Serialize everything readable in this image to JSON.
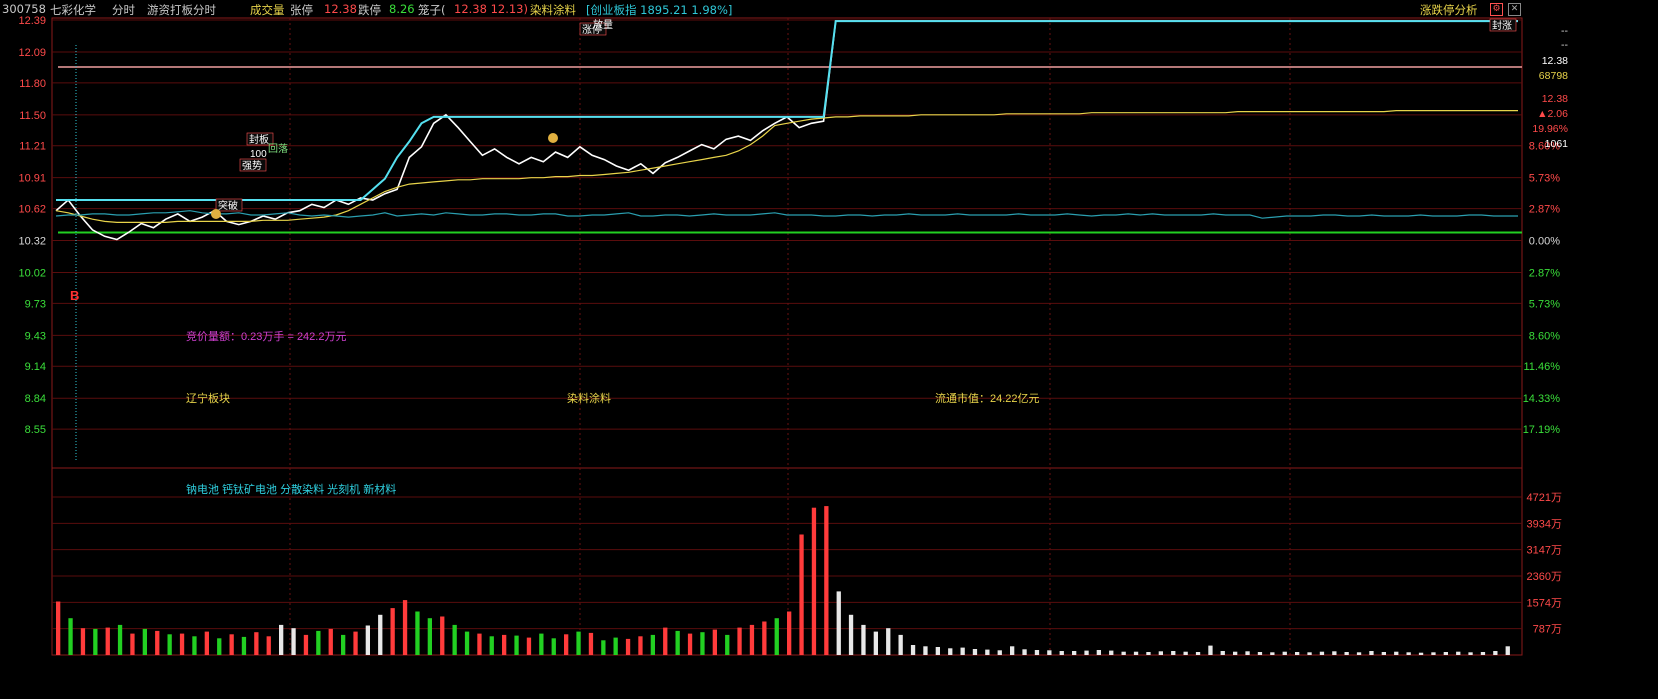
{
  "header": {
    "code": "300758",
    "name": "七彩化学",
    "mode": "分时",
    "strategy": "游资打板分时",
    "vol_label": "成交量",
    "limit_up_label": "张停",
    "limit_up_value": "12.38",
    "limit_down_label": "跌停",
    "limit_down_value": "8.26",
    "box_label": "笼子(",
    "box_values": "12.38 12.13)",
    "sector": "染料涂料",
    "index_text": "[创业板指 1895.21 1.98%]",
    "analysis_link": "涨跌停分析",
    "ctrl_icons": [
      "settings-icon",
      "close-icon"
    ]
  },
  "right_panel": {
    "dash1": "--",
    "dash2": "--",
    "price": "12.38",
    "volume": "68798",
    "price2": "12.38",
    "change": "▲2.06",
    "change_pct": "19.96%",
    "last_vol": "1061"
  },
  "chart_data": {
    "type": "line",
    "title": "300758 七彩化学 分时",
    "price_axis": {
      "ylim": [
        8.26,
        12.39
      ],
      "left_ticks": [
        "12.39",
        "12.09",
        "11.80",
        "11.50",
        "11.21",
        "10.91",
        "10.62",
        "10.32",
        "10.02",
        "9.73",
        "9.43",
        "9.14",
        "8.84",
        "8.55"
      ],
      "right_ticks": [
        "",
        "",
        "",
        "",
        "8.60%",
        "5.73%",
        "2.87%",
        "0.00%",
        "2.87%",
        "5.73%",
        "8.60%",
        "11.46%",
        "14.33%",
        "17.19%"
      ]
    },
    "prev_close": 10.32,
    "limit_up": 12.38,
    "limit_down": 8.26,
    "volume_axis": {
      "ticks": [
        "4721万",
        "3934万",
        "3147万",
        "2360万",
        "1574万",
        "787万"
      ]
    },
    "annotations": [
      {
        "text": "B",
        "kind": "buy"
      },
      {
        "text": "突破",
        "kind": "tag"
      },
      {
        "text": "强势",
        "kind": "tag"
      },
      {
        "text": "封板",
        "kind": "tag"
      },
      {
        "text": "回落",
        "kind": "tag"
      },
      {
        "text": "涨停",
        "kind": "tag"
      },
      {
        "text": "放量",
        "kind": "tag"
      },
      {
        "text": "封涨",
        "kind": "tag"
      },
      {
        "text": "100",
        "kind": "label"
      }
    ],
    "notes": {
      "auction": "竞价量额：0.23万手 = 242.2万元",
      "region": "辽宁板块",
      "industry": "染料涂料",
      "float_cap": "流通市值：24.22亿元",
      "concepts": "钠电池 钙钛矿电池 分散染料 光刻机 新材料"
    },
    "series": [
      {
        "name": "价格",
        "color": "#ffffff",
        "values": [
          10.6,
          10.7,
          10.55,
          10.42,
          10.36,
          10.33,
          10.4,
          10.48,
          10.44,
          10.52,
          10.57,
          10.5,
          10.54,
          10.6,
          10.5,
          10.47,
          10.5,
          10.55,
          10.52,
          10.58,
          10.6,
          10.66,
          10.63,
          10.7,
          10.66,
          10.72,
          10.7,
          10.76,
          10.8,
          11.1,
          11.2,
          11.42,
          11.5,
          11.38,
          11.25,
          11.12,
          11.18,
          11.1,
          11.04,
          11.1,
          11.06,
          11.15,
          11.1,
          11.2,
          11.12,
          11.08,
          11.02,
          10.98,
          11.04,
          10.95,
          11.05,
          11.1,
          11.16,
          11.22,
          11.18,
          11.27,
          11.3,
          11.26,
          11.35,
          11.42,
          11.48,
          11.38,
          11.42,
          11.44,
          12.38,
          12.38,
          12.38,
          12.38,
          12.38,
          12.38,
          12.38,
          12.38,
          12.38,
          12.38,
          12.38,
          12.38,
          12.38,
          12.38,
          12.38,
          12.38,
          12.38,
          12.38,
          12.38,
          12.38,
          12.38,
          12.38,
          12.38,
          12.38,
          12.38,
          12.38,
          12.38,
          12.38,
          12.38,
          12.38,
          12.38,
          12.38,
          12.38,
          12.38,
          12.38,
          12.38,
          12.38,
          12.38,
          12.38,
          12.38,
          12.38,
          12.38,
          12.38,
          12.38,
          12.38,
          12.38,
          12.38,
          12.38,
          12.38,
          12.38,
          12.38,
          12.38,
          12.38,
          12.38,
          12.38,
          12.38,
          12.38
        ]
      },
      {
        "name": "均价",
        "color": "#e8d44a",
        "values": [
          10.6,
          10.58,
          10.55,
          10.52,
          10.5,
          10.49,
          10.49,
          10.49,
          10.49,
          10.49,
          10.5,
          10.5,
          10.5,
          10.5,
          10.5,
          10.5,
          10.5,
          10.51,
          10.51,
          10.51,
          10.52,
          10.53,
          10.54,
          10.56,
          10.6,
          10.66,
          10.72,
          10.78,
          10.82,
          10.85,
          10.86,
          10.87,
          10.88,
          10.89,
          10.89,
          10.9,
          10.9,
          10.9,
          10.9,
          10.91,
          10.91,
          10.92,
          10.92,
          10.93,
          10.93,
          10.94,
          10.95,
          10.96,
          10.98,
          11.0,
          11.02,
          11.04,
          11.06,
          11.08,
          11.1,
          11.12,
          11.16,
          11.22,
          11.3,
          11.4,
          11.42,
          11.44,
          11.46,
          11.47,
          11.48,
          11.48,
          11.49,
          11.49,
          11.49,
          11.49,
          11.49,
          11.5,
          11.5,
          11.5,
          11.5,
          11.5,
          11.5,
          11.5,
          11.51,
          11.51,
          11.51,
          11.51,
          11.51,
          11.51,
          11.51,
          11.52,
          11.52,
          11.52,
          11.52,
          11.52,
          11.52,
          11.52,
          11.52,
          11.52,
          11.52,
          11.52,
          11.52,
          11.53,
          11.53,
          11.53,
          11.53,
          11.53,
          11.53,
          11.53,
          11.53,
          11.53,
          11.53,
          11.53,
          11.53,
          11.53,
          11.54,
          11.54,
          11.54,
          11.54,
          11.54,
          11.54,
          11.54,
          11.54,
          11.54,
          11.54,
          11.54
        ]
      },
      {
        "name": "板块",
        "color": "#2a9fb0",
        "values": [
          10.55,
          10.56,
          10.56,
          10.57,
          10.57,
          10.56,
          10.56,
          10.57,
          10.58,
          10.58,
          10.59,
          10.6,
          10.58,
          10.57,
          10.57,
          10.58,
          10.56,
          10.56,
          10.57,
          10.58,
          10.56,
          10.55,
          10.56,
          10.55,
          10.54,
          10.55,
          10.56,
          10.58,
          10.55,
          10.56,
          10.57,
          10.56,
          10.58,
          10.57,
          10.56,
          10.56,
          10.57,
          10.57,
          10.56,
          10.56,
          10.57,
          10.57,
          10.55,
          10.55,
          10.56,
          10.56,
          10.57,
          10.58,
          10.55,
          10.55,
          10.56,
          10.56,
          10.55,
          10.56,
          10.57,
          10.56,
          10.56,
          10.56,
          10.57,
          10.58,
          10.56,
          10.56,
          10.56,
          10.55,
          10.55,
          10.56,
          10.56,
          10.55,
          10.56,
          10.56,
          10.57,
          10.56,
          10.56,
          10.56,
          10.57,
          10.56,
          10.56,
          10.56,
          10.56,
          10.57,
          10.56,
          10.56,
          10.56,
          10.57,
          10.56,
          10.55,
          10.56,
          10.56,
          10.57,
          10.56,
          10.57,
          10.56,
          10.56,
          10.56,
          10.56,
          10.57,
          10.56,
          10.56,
          10.56,
          10.53,
          10.54,
          10.55,
          10.55,
          10.55,
          10.56,
          10.56,
          10.55,
          10.55,
          10.56,
          10.55,
          10.55,
          10.55,
          10.56,
          10.55,
          10.55,
          10.55,
          10.56,
          10.56,
          10.55,
          10.55,
          10.55
        ]
      },
      {
        "name": "上沿",
        "color": "#55e0f0",
        "values": [
          10.7,
          10.7,
          10.7,
          10.7,
          10.7,
          10.7,
          10.7,
          10.7,
          10.7,
          10.7,
          10.7,
          10.7,
          10.7,
          10.7,
          10.7,
          10.7,
          10.7,
          10.7,
          10.7,
          10.7,
          10.7,
          10.7,
          10.7,
          10.7,
          10.7,
          10.7,
          10.8,
          10.9,
          11.1,
          11.25,
          11.42,
          11.48,
          11.48,
          11.48,
          11.48,
          11.48,
          11.48,
          11.48,
          11.48,
          11.48,
          11.48,
          11.48,
          11.48,
          11.48,
          11.48,
          11.48,
          11.48,
          11.48,
          11.48,
          11.48,
          11.48,
          11.48,
          11.48,
          11.48,
          11.48,
          11.48,
          11.48,
          11.48,
          11.48,
          11.48,
          11.48,
          11.48,
          11.48,
          11.48,
          12.38,
          12.38,
          12.38,
          12.38,
          12.38,
          12.38,
          12.38,
          12.38,
          12.38,
          12.38,
          12.38,
          12.38,
          12.38,
          12.38,
          12.38,
          12.38,
          12.38,
          12.38,
          12.38,
          12.38,
          12.38,
          12.38,
          12.38,
          12.38,
          12.38,
          12.38,
          12.38,
          12.38,
          12.38,
          12.38,
          12.38,
          12.38,
          12.38,
          12.38,
          12.38,
          12.38,
          12.38,
          12.38,
          12.38,
          12.38,
          12.38,
          12.38,
          12.38,
          12.38,
          12.38,
          12.38,
          12.38,
          12.38,
          12.38,
          12.38,
          12.38,
          12.38,
          12.38,
          12.38,
          12.38,
          12.38,
          12.38
        ]
      }
    ],
    "volume": [
      1600,
      1100,
      800,
      780,
      820,
      900,
      640,
      780,
      720,
      620,
      640,
      560,
      700,
      500,
      620,
      540,
      680,
      560,
      900,
      800,
      600,
      720,
      780,
      600,
      700,
      880,
      1200,
      1400,
      1640,
      1300,
      1100,
      1150,
      900,
      700,
      640,
      560,
      600,
      580,
      520,
      640,
      500,
      620,
      700,
      660,
      440,
      520,
      480,
      560,
      600,
      820,
      720,
      640,
      680,
      760,
      600,
      820,
      900,
      1000,
      1100,
      1300,
      3600,
      4400,
      4450,
      1900,
      1200,
      900,
      700,
      800,
      600,
      300,
      260,
      240,
      200,
      220,
      180,
      160,
      140,
      260,
      170,
      150,
      140,
      120,
      120,
      130,
      150,
      130,
      100,
      100,
      90,
      110,
      120,
      100,
      90,
      280,
      120,
      100,
      110,
      90,
      80,
      100,
      90,
      80,
      100,
      110,
      90,
      80,
      120,
      90,
      100,
      80,
      70,
      80,
      90,
      100,
      80,
      90,
      120,
      260
    ],
    "volume_colors": [
      "r",
      "g",
      "r",
      "g",
      "r",
      "g",
      "r",
      "g",
      "r",
      "g",
      "r",
      "g",
      "r",
      "g",
      "r",
      "g",
      "r",
      "r",
      "w",
      "w",
      "r",
      "g",
      "r",
      "g",
      "r",
      "w",
      "w",
      "r",
      "r",
      "g",
      "g",
      "r",
      "g",
      "g",
      "r",
      "g",
      "r",
      "g",
      "r",
      "g",
      "g",
      "r",
      "g",
      "r",
      "g",
      "g",
      "r",
      "r",
      "g",
      "r",
      "g",
      "r",
      "g",
      "r",
      "g",
      "r",
      "r",
      "r",
      "g",
      "r",
      "r",
      "r",
      "r",
      "w",
      "w",
      "w",
      "w",
      "w",
      "w",
      "w",
      "w",
      "w",
      "w",
      "w",
      "w",
      "w",
      "w",
      "w",
      "w",
      "w",
      "w",
      "w",
      "w",
      "w",
      "w",
      "w",
      "w",
      "w",
      "w",
      "w",
      "w",
      "w",
      "w",
      "w",
      "w",
      "w",
      "w",
      "w",
      "w",
      "w",
      "w",
      "w",
      "w",
      "w",
      "w",
      "w",
      "w",
      "w",
      "w",
      "w",
      "w",
      "w",
      "w",
      "w",
      "w",
      "w",
      "w",
      "w",
      "w",
      "w",
      "w"
    ]
  }
}
